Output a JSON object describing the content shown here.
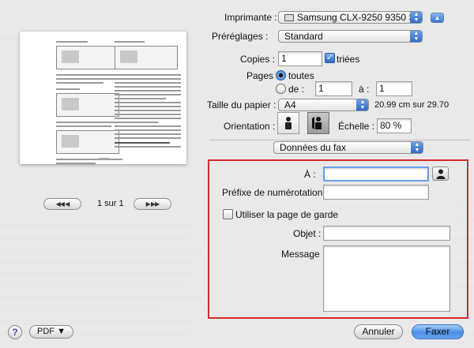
{
  "printer": {
    "label": "Imprimante :",
    "value": "Samsung CLX-9250 9350 S...",
    "disclosure_icon": "triangle-up-icon"
  },
  "presets": {
    "label": "Préréglages :",
    "value": "Standard"
  },
  "copies": {
    "label": "Copies :",
    "value": "1",
    "collated_label": "triées",
    "collated": true
  },
  "pages": {
    "label": "Pages :",
    "all_label": "toutes",
    "from_label": "de :",
    "from_value": "1",
    "to_label": "à :",
    "to_value": "1",
    "selected": "toutes"
  },
  "paper": {
    "label": "Taille du papier :",
    "value": "A4",
    "dimensions": "20.99 cm sur 29.70"
  },
  "orientation": {
    "label": "Orientation :",
    "selected": "landscape"
  },
  "scale": {
    "label": "Échelle :",
    "value": "80 %"
  },
  "section_popup": {
    "value": "Données du fax"
  },
  "fax": {
    "to_label": "À :",
    "to_value": "",
    "prefix_label": "Préfixe de numérotation :",
    "prefix_value": "",
    "cover_label": "Utiliser la page de garde",
    "cover_checked": false,
    "subject_label": "Objet :",
    "subject_value": "",
    "message_label": "Message :",
    "message_value": "",
    "highlight_color": "#d32a2a"
  },
  "preview": {
    "page_label": "1 sur 1"
  },
  "buttons": {
    "pdf": "PDF ▼",
    "cancel": "Annuler",
    "send": "Faxer",
    "help": "?"
  },
  "colors": {
    "accent": "#3a74d2",
    "sheet": "#e8e8e8"
  }
}
